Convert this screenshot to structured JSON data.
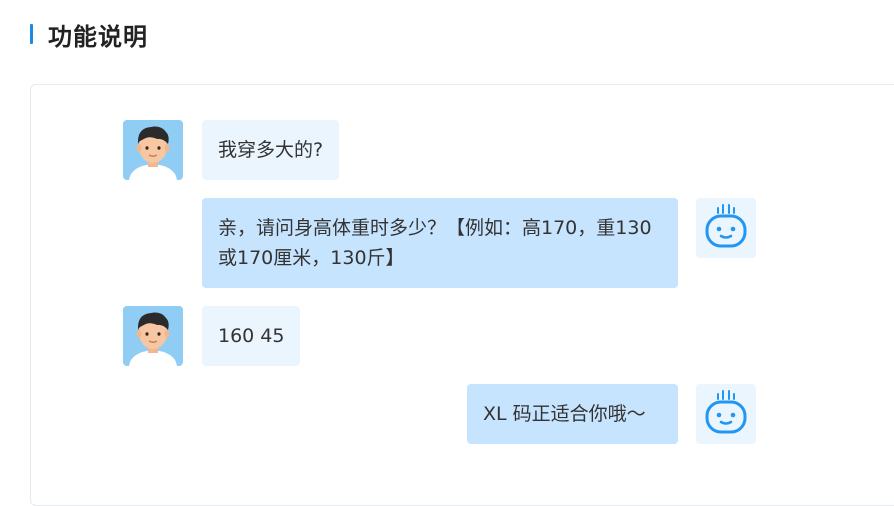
{
  "header": {
    "title": "功能说明",
    "accent_color": "#1e88e5"
  },
  "chat": {
    "messages": [
      {
        "sender": "user",
        "avatar_icon": "user-avatar-icon",
        "text": "我穿多大的?"
      },
      {
        "sender": "bot",
        "avatar_icon": "robot-avatar-icon",
        "text": "亲，请问身高体重时多少？【例如：高170，重130 或170厘米，130斤】"
      },
      {
        "sender": "user",
        "avatar_icon": "user-avatar-icon",
        "text": "160 45"
      },
      {
        "sender": "bot",
        "avatar_icon": "robot-avatar-icon",
        "text": "XL 码正适合你哦～"
      }
    ]
  },
  "colors": {
    "user_bubble": "#eaf5fe",
    "bot_bubble": "#c7e4fe",
    "panel_border": "#e6e9ee",
    "robot_icon": "#2196f3"
  }
}
